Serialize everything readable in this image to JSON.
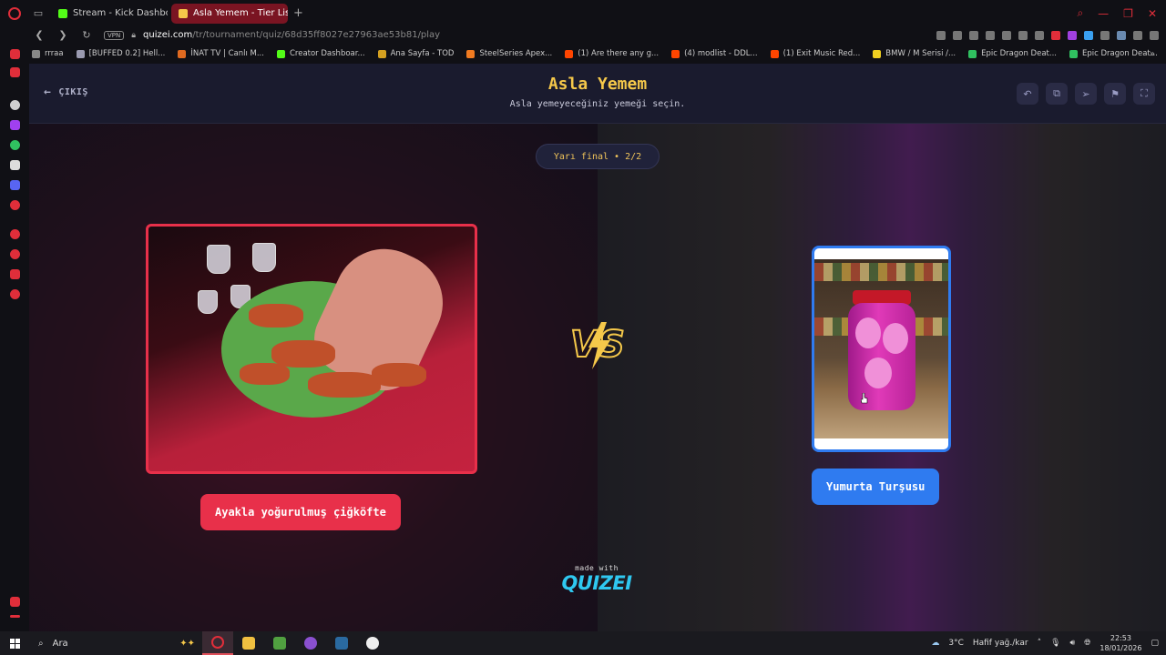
{
  "browser": {
    "tabs": [
      {
        "title": "Stream - Kick Dashboa",
        "active": false,
        "favicon_color": "#53fc18"
      },
      {
        "title": "Asla Yemem - Tier List, Kö",
        "active": true,
        "favicon_color": "#f5c84a"
      }
    ],
    "new_tab_label": "+",
    "url_host": "quizei.com",
    "url_path": "/tr/tournament/quiz/68d35ff8027e27963ae53b81/play",
    "vpn_label": "VPN",
    "bookmarks": [
      {
        "label": "rrraa",
        "color": "#888888"
      },
      {
        "label": "[BUFFED 0.2] Hell...",
        "color": "#9a9ab0"
      },
      {
        "label": "İNAT TV | Canlı M...",
        "color": "#e06a20"
      },
      {
        "label": "Creator Dashboar...",
        "color": "#53fc18"
      },
      {
        "label": "Ana Sayfa - TOD",
        "color": "#d4a020"
      },
      {
        "label": "SteelSeries Apex...",
        "color": "#f07a20"
      },
      {
        "label": "(1) Are there any g...",
        "color": "#ff4500"
      },
      {
        "label": "(4) modlist - DDL...",
        "color": "#ff4500"
      },
      {
        "label": "(1) Exit Music Red...",
        "color": "#ff4500"
      },
      {
        "label": "BMW / M Serisi /...",
        "color": "#f0d020"
      },
      {
        "label": "Epic Dragon Deat...",
        "color": "#30c060"
      },
      {
        "label": "Epic Dragon Deat...",
        "color": "#30c060"
      }
    ],
    "more_label": "»"
  },
  "page": {
    "exit_label": "ÇIKIŞ",
    "title": "Asla Yemem",
    "subtitle": "Asla yemeyeceğiniz yemeği seçin.",
    "round_label": "Yarı final • 2/2",
    "vs_label": "VS",
    "left_choice": {
      "label": "Ayakla yoğurulmuş çiğköfte",
      "accent": "#e8304a"
    },
    "right_choice": {
      "label": "Yumurta Turşusu",
      "accent": "#2f7bf0"
    },
    "made_with_label": "made with",
    "brand_label": "QUIZEI",
    "header_actions": [
      "undo-icon",
      "copy-icon",
      "share-icon",
      "flag-icon",
      "fullscreen-icon"
    ]
  },
  "taskbar": {
    "search_placeholder": "Ara",
    "weather": "3°C",
    "weather_desc": "Hafif yağ./kar",
    "time": "22:53",
    "date": "18/01/2026"
  }
}
